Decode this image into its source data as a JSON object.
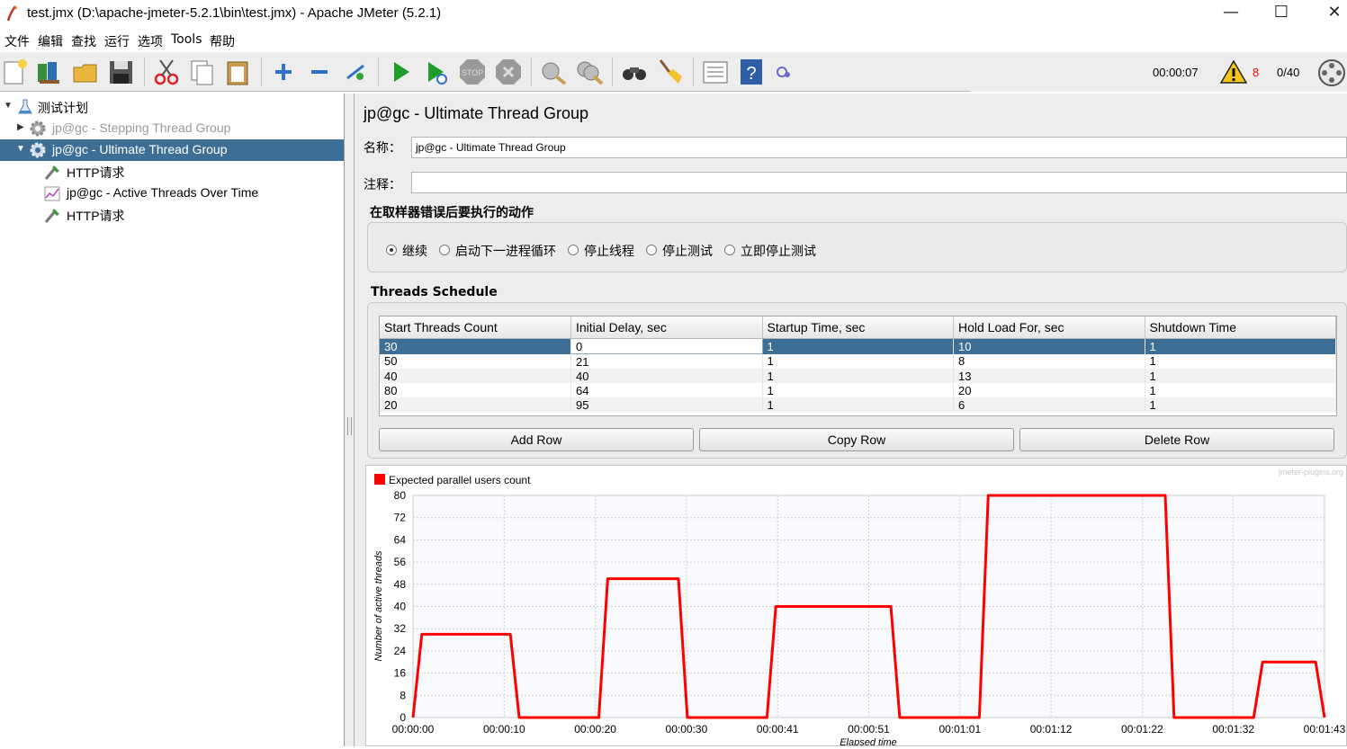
{
  "window": {
    "title": "test.jmx (D:\\apache-jmeter-5.2.1\\bin\\test.jmx) - Apache JMeter (5.2.1)",
    "minimize": "—",
    "maximize": "☐",
    "close": "✕"
  },
  "menu": [
    "文件",
    "编辑",
    "查找",
    "运行",
    "选项",
    "Tools",
    "帮助"
  ],
  "toolbar": {
    "icons": [
      "new-icon",
      "templates-icon",
      "open-icon",
      "save-icon",
      "cut-icon",
      "copy-icon",
      "paste-icon",
      "expand-icon",
      "collapse-icon",
      "toggle-icon",
      "start-icon",
      "start-no-pause-icon",
      "stop-icon",
      "shutdown-icon",
      "clear-icon",
      "clear-all-icon",
      "search-icon",
      "reset-search-icon",
      "function-helper-icon",
      "help-icon",
      "remote-icon"
    ],
    "elapsed": "00:00:07",
    "warnings": "8",
    "threads": "0/40"
  },
  "tree": {
    "items": [
      {
        "label": "测试计划",
        "icon": "test-plan-icon",
        "state": "normal"
      },
      {
        "label": "jp@gc - Stepping Thread Group",
        "icon": "gear-icon",
        "state": "disabled"
      },
      {
        "label": "jp@gc - Ultimate Thread Group",
        "icon": "gear-icon",
        "state": "selected"
      },
      {
        "label": "HTTP请求",
        "icon": "sampler-icon",
        "state": "normal"
      },
      {
        "label": "jp@gc - Active Threads Over Time",
        "icon": "graph-icon",
        "state": "normal"
      },
      {
        "label": "HTTP请求",
        "icon": "sampler-icon",
        "state": "normal"
      }
    ]
  },
  "panel": {
    "title": "jp@gc - Ultimate Thread Group",
    "name_label": "名称：",
    "name_value": "jp@gc - Ultimate Thread Group",
    "comment_label": "注释：",
    "comment_value": "",
    "error_section": "在取样器错误后要执行的动作",
    "error_options": [
      "继续",
      "启动下一进程循环",
      "停止线程",
      "停止测试",
      "立即停止测试"
    ],
    "error_selected": "继续",
    "schedule_title": "Threads Schedule",
    "columns": [
      "Start Threads Count",
      "Initial Delay, sec",
      "Startup Time, sec",
      "Hold Load For, sec",
      "Shutdown Time"
    ],
    "rows": [
      [
        "30",
        "0",
        "1",
        "10",
        "1"
      ],
      [
        "50",
        "21",
        "1",
        "8",
        "1"
      ],
      [
        "40",
        "40",
        "1",
        "13",
        "1"
      ],
      [
        "80",
        "64",
        "1",
        "20",
        "1"
      ],
      [
        "20",
        "95",
        "1",
        "6",
        "1"
      ]
    ],
    "buttons": {
      "add": "Add Row",
      "copy": "Copy Row",
      "delete": "Delete Row"
    }
  },
  "chart_data": {
    "type": "line",
    "legend": "Expected parallel users count",
    "watermark": "jmeter-plugins.org",
    "xlabel": "Elapsed time",
    "ylabel": "Number of active threads",
    "ylim": [
      0,
      80
    ],
    "yticks": [
      0,
      8,
      16,
      24,
      32,
      40,
      48,
      56,
      64,
      72,
      80
    ],
    "xticks": [
      "00:00:00",
      "00:00:10",
      "00:00:20",
      "00:00:30",
      "00:00:41",
      "00:00:51",
      "00:01:01",
      "00:01:12",
      "00:01:22",
      "00:01:32",
      "00:01:43"
    ],
    "xlim": [
      0,
      103
    ],
    "series": [
      {
        "name": "Expected parallel users count",
        "color": "#ff0000",
        "points": [
          [
            0,
            0
          ],
          [
            1,
            30
          ],
          [
            11,
            30
          ],
          [
            12,
            0
          ],
          [
            21,
            0
          ],
          [
            22,
            50
          ],
          [
            30,
            50
          ],
          [
            31,
            0
          ],
          [
            40,
            0
          ],
          [
            41,
            40
          ],
          [
            54,
            40
          ],
          [
            55,
            0
          ],
          [
            64,
            0
          ],
          [
            65,
            80
          ],
          [
            85,
            80
          ],
          [
            86,
            0
          ],
          [
            95,
            0
          ],
          [
            96,
            20
          ],
          [
            102,
            20
          ],
          [
            103,
            0
          ]
        ]
      }
    ]
  },
  "colors": {
    "selection": "#3d6f96",
    "series": "#ff0000",
    "warning": "#ff0000"
  }
}
